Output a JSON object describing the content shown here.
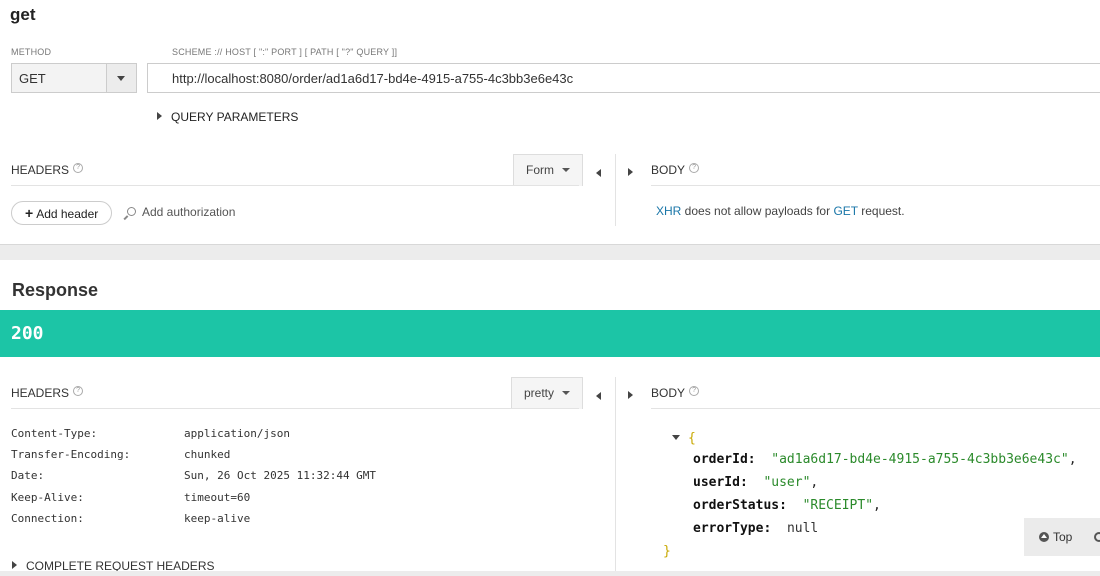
{
  "request": {
    "title": "get",
    "method_label": "METHOD",
    "method_value": "GET",
    "url_label": "SCHEME :// HOST [ \":\" PORT ] [ PATH [ \"?\" QUERY ]]",
    "url_value": "http://localhost:8080/order/ad1a6d17-bd4e-4915-a755-4c3bb3e6e43c",
    "query_params_label": "QUERY PARAMETERS",
    "headers_title": "HEADERS",
    "headers_mode": "Form",
    "body_title": "BODY",
    "add_header_label": "Add header",
    "add_auth_label": "Add authorization",
    "body_note": {
      "xhr": "XHR",
      "middle": " does not allow payloads for ",
      "method": "GET",
      "end": " request."
    }
  },
  "response": {
    "title": "Response",
    "status_code": "200",
    "status_color": "#1cc5a6",
    "headers_title": "HEADERS",
    "headers_mode": "pretty",
    "body_title": "BODY",
    "headers": [
      {
        "name": "Content-Type:",
        "value": "application/json"
      },
      {
        "name": "Transfer-Encoding:",
        "value": "chunked"
      },
      {
        "name": "Date:",
        "value": "Sun, 26 Oct 2025 11:32:44 GMT"
      },
      {
        "name": "Keep-Alive:",
        "value": "timeout=60"
      },
      {
        "name": "Connection:",
        "value": "keep-alive"
      }
    ],
    "complete_headers_label": "COMPLETE REQUEST HEADERS",
    "body_json": {
      "open": "{",
      "close": "}",
      "fields": [
        {
          "key": "orderId:",
          "value": "\"ad1a6d17-bd4e-4915-a755-4c3bb3e6e43c\"",
          "sep": ","
        },
        {
          "key": "userId:",
          "value": "\"user\"",
          "sep": ","
        },
        {
          "key": "orderStatus:",
          "value": "\"RECEIPT\"",
          "sep": ","
        },
        {
          "key": "errorType:",
          "value": "null",
          "sep": ""
        }
      ]
    }
  },
  "top_button_label": "Top"
}
